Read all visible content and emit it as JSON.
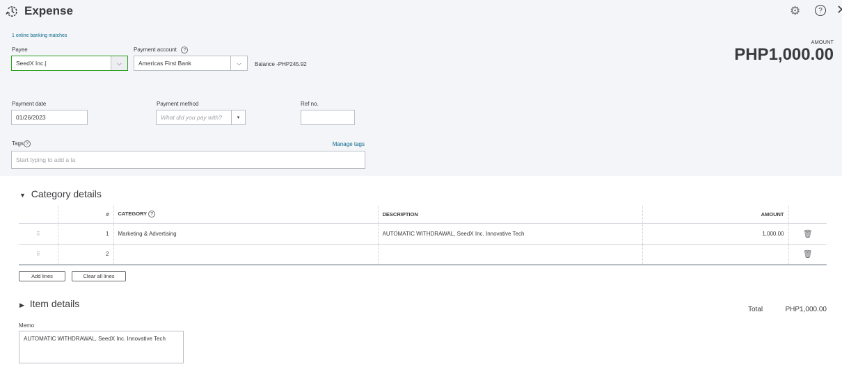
{
  "header": {
    "title": "Expense",
    "amount_label": "AMOUNT",
    "amount": "PHP1,000.00"
  },
  "banking_matches": "1 online banking matches",
  "payee": {
    "label": "Payee",
    "value": "SeedX Inc."
  },
  "payment_account": {
    "label": "Payment account",
    "value": "Americas First Bank",
    "balance": "Balance -PHP245.92"
  },
  "payment_date": {
    "label": "Payment date",
    "value": "01/26/2023"
  },
  "payment_method": {
    "label": "Payment method",
    "placeholder": "What did you pay with?"
  },
  "ref_no": {
    "label": "Ref no.",
    "value": ""
  },
  "tags": {
    "label": "Tags",
    "placeholder": "Start typing to add a ta",
    "manage": "Manage tags"
  },
  "category_details": {
    "title": "Category details",
    "columns": [
      "#",
      "CATEGORY",
      "DESCRIPTION",
      "AMOUNT"
    ],
    "rows": [
      {
        "n": "1",
        "category": "Marketing & Advertising",
        "description": "AUTOMATIC WITHDRAWAL, SeedX Inc. Innovative Tech",
        "amount": "1,000.00"
      },
      {
        "n": "2",
        "category": "",
        "description": "",
        "amount": ""
      }
    ],
    "add_lines": "Add lines",
    "clear_lines": "Clear all lines"
  },
  "item_details": {
    "title": "Item details"
  },
  "total": {
    "label": "Total",
    "value": "PHP1,000.00"
  },
  "memo": {
    "label": "Memo",
    "value": "AUTOMATIC WITHDRAWAL, SeedX Inc. Innovative Tech"
  }
}
